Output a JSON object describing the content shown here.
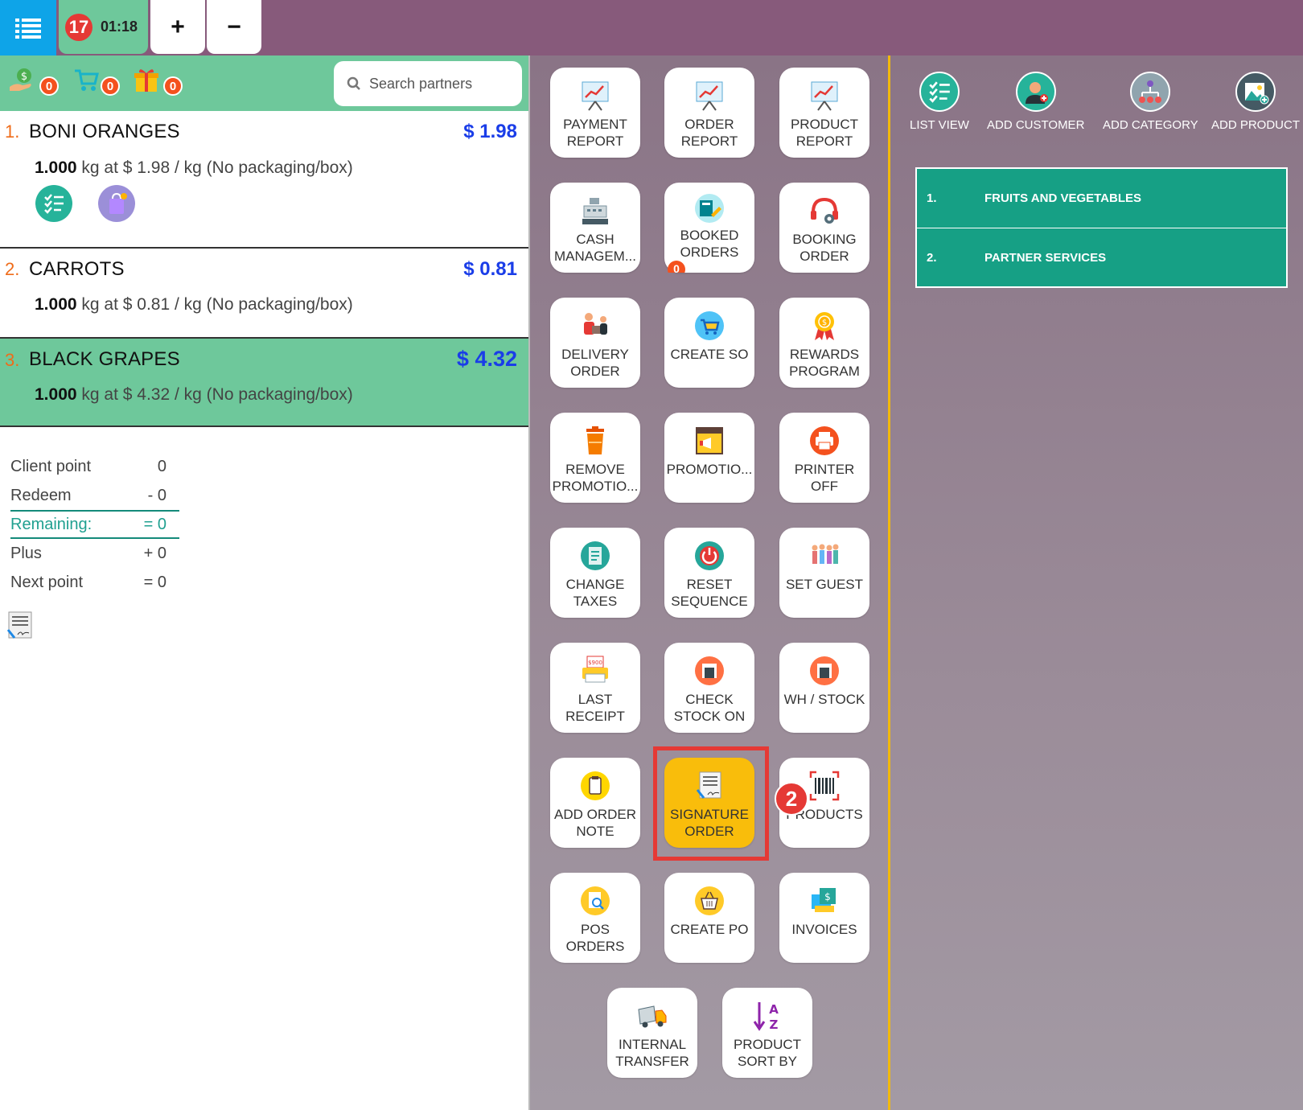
{
  "topbar": {
    "order_number": "17",
    "order_time": "01:18",
    "add_label": "+",
    "remove_label": "−"
  },
  "header": {
    "wallet_count": "0",
    "cart_count": "0",
    "gift_count": "0",
    "search_placeholder": "Search partners"
  },
  "order_lines": [
    {
      "index": "1.",
      "name": "BONI ORANGES",
      "price": "$ 1.98",
      "qty": "1.000",
      "detail": "kg at $ 1.98 / kg (No packaging/box)"
    },
    {
      "index": "2.",
      "name": "CARROTS",
      "price": "$ 0.81",
      "qty": "1.000",
      "detail": "kg at $ 0.81 / kg (No packaging/box)"
    },
    {
      "index": "3.",
      "name": "BLACK GRAPES",
      "price": "$ 4.32",
      "qty": "1.000",
      "detail": "kg at $ 4.32 / kg (No packaging/box)"
    }
  ],
  "points": {
    "client_point_label": "Client point",
    "client_point_value": "0",
    "redeem_label": "Redeem",
    "redeem_value": "- 0",
    "remaining_label": "Remaining:",
    "remaining_value": "= 0",
    "plus_label": "Plus",
    "plus_value": "+ 0",
    "next_label": "Next point",
    "next_value": "= 0"
  },
  "actions": {
    "payment_report": [
      "PAYMENT",
      "REPORT"
    ],
    "order_report": [
      "ORDER",
      "REPORT"
    ],
    "product_report": [
      "PRODUCT",
      "REPORT"
    ],
    "cash_management": [
      "CASH",
      "MANAGEM..."
    ],
    "booked_orders": [
      "BOOKED",
      "ORDERS"
    ],
    "booked_orders_count": "0",
    "booking_order": [
      "BOOKING",
      "ORDER"
    ],
    "delivery_order": [
      "DELIVERY",
      "ORDER"
    ],
    "create_so": [
      "CREATE SO"
    ],
    "rewards_program": [
      "REWARDS",
      "PROGRAM"
    ],
    "remove_promotion": [
      "REMOVE",
      "PROMOTIO..."
    ],
    "promotion": [
      "PROMOTIO..."
    ],
    "printer_off": [
      "PRINTER",
      "OFF"
    ],
    "change_taxes": [
      "CHANGE",
      "TAXES"
    ],
    "reset_sequence": [
      "RESET",
      "SEQUENCE"
    ],
    "set_guest": [
      "SET GUEST"
    ],
    "last_receipt": [
      "LAST",
      "RECEIPT"
    ],
    "check_stock_on": [
      "CHECK",
      "STOCK ON"
    ],
    "wh_stock": [
      "WH / STOCK"
    ],
    "add_order_note": [
      "ADD ORDER",
      "NOTE"
    ],
    "signature_order": [
      "SIGNATURE",
      "ORDER"
    ],
    "products": [
      "PRODUCTS"
    ],
    "pos_orders": [
      "POS",
      "ORDERS"
    ],
    "create_po": [
      "CREATE PO"
    ],
    "invoices": [
      "INVOICES"
    ],
    "internal_transfer": [
      "INTERNAL",
      "TRANSFER"
    ],
    "product_sort_by": [
      "PRODUCT",
      "SORT BY"
    ]
  },
  "step_badge": "2",
  "right_toolbar": {
    "list_view": "LIST VIEW",
    "add_customer": "ADD CUSTOMER",
    "add_category": "ADD CATEGORY",
    "add_product": "ADD PRODUCT"
  },
  "categories": [
    {
      "index": "1.",
      "name": "FRUITS AND VEGETABLES"
    },
    {
      "index": "2.",
      "name": "PARTNER SERVICES"
    }
  ],
  "colors": {
    "topbar": "#875a7b",
    "accent_green": "#6ec89b",
    "menu_blue": "#0ea4e8",
    "category_teal": "#16a085",
    "highlight_yellow": "#f9bd0b",
    "price_blue": "#1a3de8",
    "badge_red": "#e53935"
  }
}
